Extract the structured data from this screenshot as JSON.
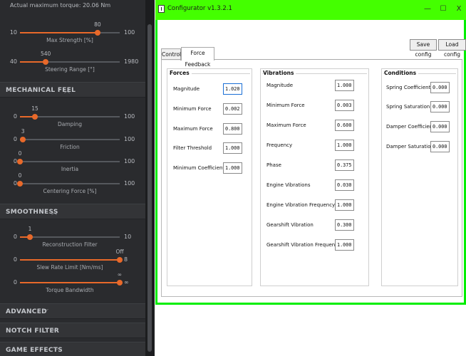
{
  "left_panel": {
    "max_torque_note": "Actual maximum torque: 20.06 Nm",
    "top_sliders": [
      {
        "name": "Max Strength [%]",
        "value": "80",
        "min": "10",
        "max": "100",
        "level": 0.778
      },
      {
        "name": "Steering Range [°]",
        "value": "540",
        "min": "40",
        "max": "1980",
        "level": 0.258
      }
    ],
    "mechanical_feel": {
      "title": "MECHANICAL FEEL",
      "sliders": [
        {
          "name": "Damping",
          "value": "15",
          "min": "0",
          "max": "100",
          "level": 0.15
        },
        {
          "name": "Friction",
          "value": "3",
          "min": "0",
          "max": "100",
          "level": 0.03
        },
        {
          "name": "Inertia",
          "value": "0",
          "min": "0",
          "max": "100",
          "level": 0.0
        },
        {
          "name": "Centering Force [%]",
          "value": "0",
          "min": "0",
          "max": "100",
          "level": 0.0
        }
      ]
    },
    "smoothness": {
      "title": "SMOOTHNESS",
      "sliders": [
        {
          "name": "Reconstruction Filter",
          "value": "1",
          "min": "0",
          "max": "10",
          "level": 0.1
        },
        {
          "name": "Slew Rate Limit [Nm/ms]",
          "value": "Off",
          "min": "0",
          "max": "8",
          "level": 1.0
        },
        {
          "name": "Torque Bandwidth",
          "value": "∞",
          "min": "0",
          "max": "∞",
          "level": 1.0
        }
      ]
    },
    "collapsed_sections": [
      "ADVANCED",
      "NOTCH FILTER",
      "GAME EFFECTS"
    ],
    "accent_color": "#e8692a"
  },
  "window": {
    "title": "Configurator v1.3.2.1",
    "controls": {
      "minimize": "—",
      "maximize": "☐",
      "close": "X"
    },
    "buttons": {
      "save": "Save config",
      "load": "Load config"
    },
    "tabs": [
      {
        "label": "Controls",
        "active": false
      },
      {
        "label": "Force Feedback",
        "active": true
      }
    ],
    "groups": {
      "forces": {
        "title": "Forces",
        "rows": [
          {
            "label": "Magnitude",
            "value": "1.020"
          },
          {
            "label": "Minimum Force",
            "value": "0.002"
          },
          {
            "label": "Maximum Force",
            "value": "0.800"
          },
          {
            "label": "Filter Threshold",
            "value": "1.000"
          },
          {
            "label": "Minimum Coefficient",
            "value": "1.000"
          }
        ]
      },
      "vibrations": {
        "title": "Vibrations",
        "rows": [
          {
            "label": "Magnitude",
            "value": "1.000"
          },
          {
            "label": "Minimum Force",
            "value": "0.003"
          },
          {
            "label": "Maximum Force",
            "value": "0.600"
          },
          {
            "label": "Frequency",
            "value": "1.000"
          },
          {
            "label": "Phase",
            "value": "0.375"
          },
          {
            "label": "Engine Vibrations",
            "value": "0.030"
          },
          {
            "label": "Engine Vibration Frequency",
            "value": "1.000"
          },
          {
            "label": "Gearshift Vibration",
            "value": "0.300"
          },
          {
            "label": "Gearshift Vibration Frequency",
            "value": "1.000"
          }
        ]
      },
      "conditions": {
        "title": "Conditions",
        "rows": [
          {
            "label": "Spring Coefficient",
            "value": "0.000"
          },
          {
            "label": "Spring Saturation",
            "value": "0.000"
          },
          {
            "label": "Damper Coefficient",
            "value": "0.000"
          },
          {
            "label": "Damper Saturation",
            "value": "0.000"
          }
        ]
      }
    }
  }
}
